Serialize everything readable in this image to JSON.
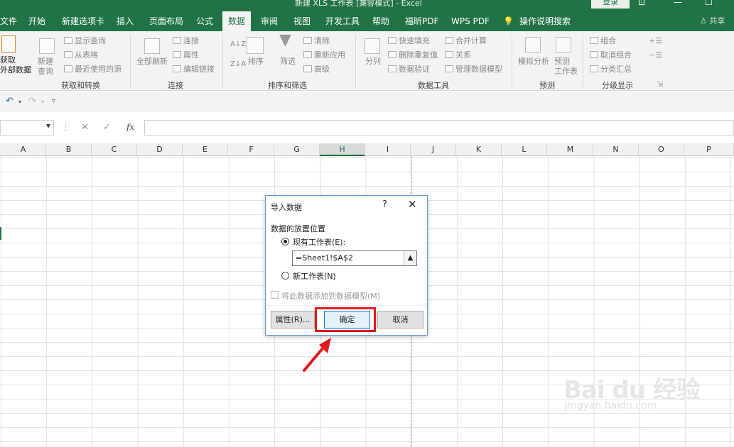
{
  "window": {
    "title": "新建 XLS 工作表 [兼容模式] - Excel",
    "login": "登录",
    "share": "共享"
  },
  "tabs": [
    "文件",
    "开始",
    "新建选项卡",
    "插入",
    "页面布局",
    "公式",
    "数据",
    "审阅",
    "视图",
    "开发工具",
    "帮助",
    "福昕PDF",
    "WPS PDF",
    "操作说明搜索"
  ],
  "active_tab": "数据",
  "ribbon": {
    "get_data": [
      "获取",
      "外部数据"
    ],
    "new_query": [
      "新建",
      "查询"
    ],
    "query_items": [
      "显示查询",
      "从表格",
      "最近使用的源"
    ],
    "refresh_all": "全部刷新",
    "conn_items": [
      "连接",
      "属性",
      "编辑链接"
    ],
    "sort": "排序",
    "filter": "筛选",
    "filter_items": [
      "清除",
      "重新应用",
      "高级"
    ],
    "split": "分列",
    "tool_items_1": [
      "快速填充",
      "删除重复值",
      "数据验证"
    ],
    "tool_items_2": [
      "合并计算",
      "关系",
      "管理数据模型"
    ],
    "what_if": "模拟分析",
    "forecast": [
      "预测",
      "工作表"
    ],
    "outline_items": [
      "组合",
      "取消组合",
      "分类汇总"
    ],
    "group_labels": [
      "获取和转换",
      "连接",
      "排序和筛选",
      "数据工具",
      "预测",
      "分级显示"
    ]
  },
  "formula_bar": {
    "fx": "fx",
    "value": ""
  },
  "columns": [
    "A",
    "B",
    "C",
    "D",
    "E",
    "F",
    "G",
    "H",
    "I",
    "J",
    "K",
    "L",
    "M",
    "N",
    "O",
    "P"
  ],
  "selected_column": "H",
  "dialog": {
    "title": "导入数据",
    "help": "?",
    "close": "✕",
    "section": "数据的放置位置",
    "existing_sheet": "现有工作表(E):",
    "reference": "=Sheet1!$A$2",
    "new_sheet": "新工作表(N)",
    "add_to_model": "将此数据添加到数据模型(M)",
    "properties_btn": "属性(R)...",
    "ok_btn": "确定",
    "cancel_btn": "取消"
  },
  "colors": {
    "excel_green": "#217346",
    "highlight_red": "#e0181c",
    "dialog_border": "#5e9ad4"
  },
  "watermark": {
    "brand": "Bai du 经验",
    "url": "jingyan.baidu.com"
  }
}
